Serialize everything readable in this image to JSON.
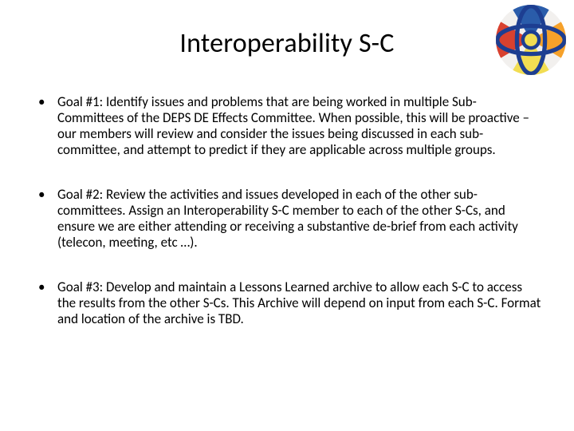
{
  "title": "Interoperability S-C",
  "logo": {
    "alt": "DEPS logo"
  },
  "bullets": [
    {
      "label": "Goal #1:",
      "text": "  Identify issues and problems that are being worked in multiple Sub-Committees of the DEPS DE Effects Committee.  When possible, this will be proactive – our members will review and consider the issues being discussed in each sub-committee, and attempt to predict if they are applicable across multiple groups."
    },
    {
      "label": "Goal #2:",
      "text": "  Review the activities and issues developed in each of the other sub-committees.  Assign an Interoperability S-C member to each of the other S-Cs, and ensure we are either attending or receiving a substantive de-brief from each activity (telecon, meeting, etc …)."
    },
    {
      "label": "Goal #3:",
      "text": " Develop and maintain a Lessons Learned archive to allow each S-C to access the results from the other S-Cs.  This Archive will depend on input from each S-C.  Format and location of the archive is TBD."
    }
  ]
}
